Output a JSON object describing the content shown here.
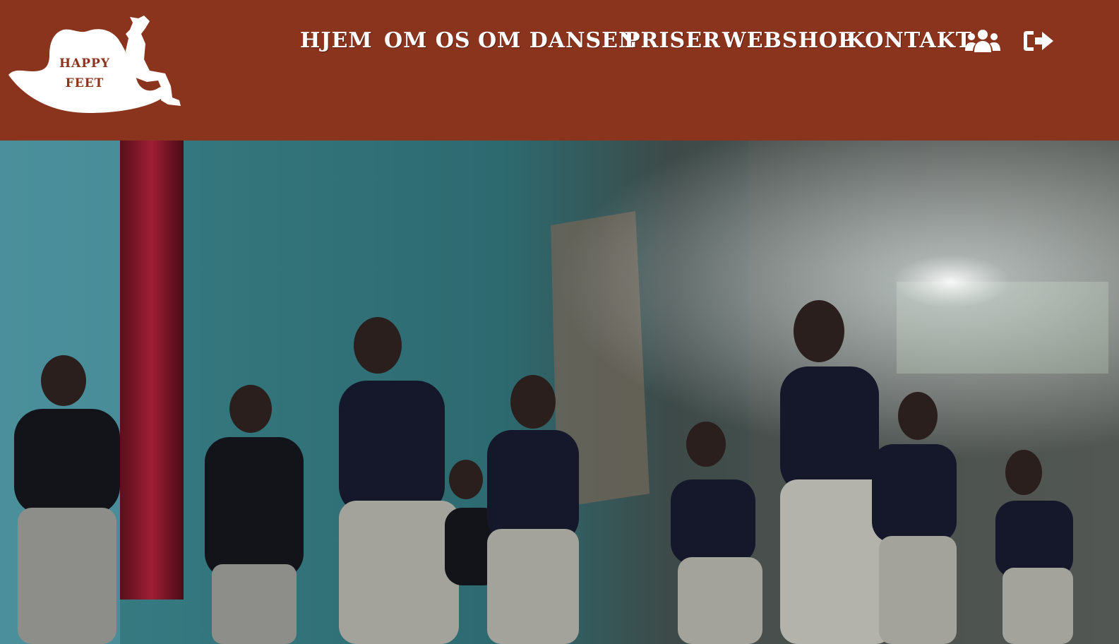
{
  "header": {
    "background": "#8b341d",
    "logo": {
      "line1": "HAPPY",
      "line2": "FEET"
    }
  },
  "nav": {
    "items": [
      {
        "label": "HJEM"
      },
      {
        "label": "OM OS"
      },
      {
        "label": "OM DANSEN"
      },
      {
        "label": "PRISER"
      },
      {
        "label": "WEBSHOP"
      },
      {
        "label": "KONTAKT"
      }
    ],
    "icons": [
      "users-icon",
      "sign-out-icon"
    ]
  },
  "hero": {
    "image": "dance-group-photo"
  }
}
